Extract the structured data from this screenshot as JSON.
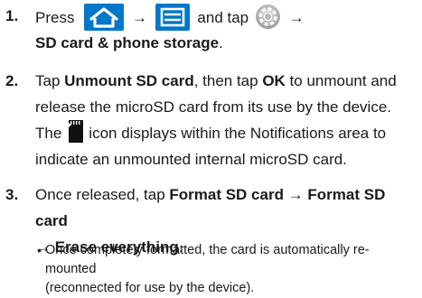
{
  "steps": [
    {
      "number": "1.",
      "text_press": "Press",
      "arrow1": "→",
      "text_and_tap": "and tap",
      "arrow2": "→",
      "text_storage": "SD card & phone storage",
      "period": ".",
      "icons": [
        "home-icon",
        "menu-icon",
        "settings-gear-icon"
      ]
    },
    {
      "number": "2.",
      "tap1": "Tap ",
      "unmount": "Unmount SD card",
      "then_tap": ", then tap ",
      "ok": "OK",
      "to_unmount": " to unmount and",
      "line2": "release the microSD card from its use by the device.",
      "line3_pre": "The",
      "line3_post": "icon displays within the Notifications area to",
      "line4": "indicate an unmounted internal microSD card.",
      "icon": "sd-card-icon"
    },
    {
      "number": "3.",
      "once": "Once released, tap ",
      "format1": "Format SD card → Format SD card",
      "erase": "→ Erase everything",
      "period": ".",
      "bullet": "•",
      "bullet_line1": "Once completely formatted, the card is automatically re-mounted",
      "bullet_line2": "(reconnected for use by the device)."
    }
  ],
  "colors": {
    "icon_blue": "#0077c8"
  }
}
